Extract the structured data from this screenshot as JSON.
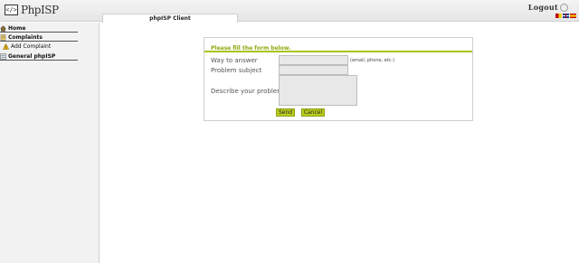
{
  "header": {
    "logo_box": "</>",
    "logo_text": "PhpISP",
    "logout_label": "Logout",
    "logout_icon": "power-icon",
    "flags": [
      "flag-icon-1",
      "flag-icon-2",
      "flag-icon-3"
    ]
  },
  "sidebar": {
    "items": [
      {
        "label": "Home",
        "icon": "house-icon"
      },
      {
        "label": "Complaints",
        "icon": "complaints-icon"
      },
      {
        "label": "Add Complaint",
        "icon": "warning-icon"
      },
      {
        "label": "General phpISP",
        "icon": "settings-icon"
      }
    ]
  },
  "tab": {
    "label": "phpISP Client"
  },
  "form": {
    "title": "Please fill the form below.",
    "fields": [
      {
        "label": "Way to answer",
        "value": "",
        "hint": "(email, phone, etc.)"
      },
      {
        "label": "Problem subject",
        "value": ""
      },
      {
        "label": "Describe your problem",
        "value": ""
      }
    ],
    "send_label": "Send",
    "cancel_label": "Cancel"
  },
  "colors": {
    "accent": "#b9cc1f",
    "title": "#8fa70c"
  }
}
